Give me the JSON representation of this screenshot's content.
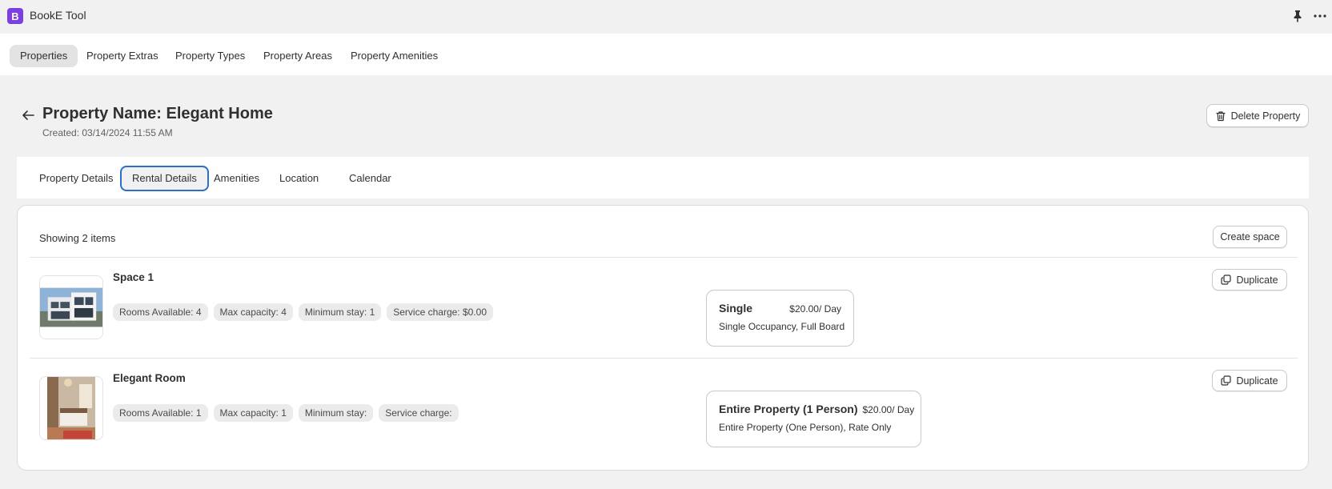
{
  "app": {
    "logo_letter": "B",
    "title": "BookE Tool",
    "accent": "#7c3fe4"
  },
  "titlebar": {
    "pin_icon": "pin-icon",
    "more_icon": "more-icon"
  },
  "nav": {
    "items": [
      {
        "label": "Properties",
        "active": true
      },
      {
        "label": "Property Extras",
        "active": false
      },
      {
        "label": "Property Types",
        "active": false
      },
      {
        "label": "Property Areas",
        "active": false
      },
      {
        "label": "Property Amenities",
        "active": false
      }
    ]
  },
  "header": {
    "title": "Property Name: Elegant Home",
    "created": "Created: 03/14/2024 11:55 AM",
    "delete_label": "Delete Property",
    "back_icon": "arrow-left-icon"
  },
  "tabs": [
    {
      "label": "Property Details",
      "active": false
    },
    {
      "label": "Rental Details",
      "active": true
    },
    {
      "label": "Amenities",
      "active": false
    },
    {
      "label": "Location",
      "active": false
    },
    {
      "label": "Calendar",
      "active": false
    }
  ],
  "list": {
    "showing": "Showing 2 items",
    "create_label": "Create space",
    "items": [
      {
        "name": "Space 1",
        "chips": [
          "Rooms Available: 4",
          "Max capacity: 4",
          "Minimum stay: 1",
          "Service charge: $0.00"
        ],
        "rate": {
          "name": "Single",
          "price": "$20.00/ Day",
          "desc": "Single Occupancy, Full Board"
        },
        "duplicate_label": "Duplicate"
      },
      {
        "name": "Elegant Room",
        "chips": [
          "Rooms Available: 1",
          "Max capacity: 1",
          "Minimum stay:",
          "Service charge:"
        ],
        "rate": {
          "name": "Entire Property (1 Person)",
          "price": "$20.00/ Day",
          "desc": "Entire Property (One Person), Rate Only"
        },
        "duplicate_label": "Duplicate"
      }
    ]
  },
  "colors": {
    "focus": "#2c6ecb",
    "background": "#f1f1f1"
  }
}
